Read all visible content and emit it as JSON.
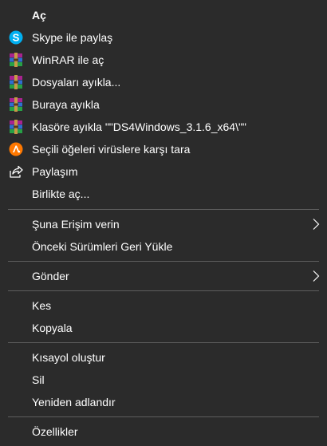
{
  "menu": {
    "items": [
      {
        "label": "Aç"
      },
      {
        "label": "Skype ile paylaş"
      },
      {
        "label": "WinRAR ile aç"
      },
      {
        "label": "Dosyaları ayıkla..."
      },
      {
        "label": "Buraya ayıkla"
      },
      {
        "label": "Klasöre ayıkla \"\"DS4Windows_3.1.6_x64\\\"\""
      },
      {
        "label": "Seçili öğeleri virüslere karşı tara"
      },
      {
        "label": "Paylaşım"
      },
      {
        "label": "Birlikte aç..."
      },
      {
        "label": "Şuna Erişim verin"
      },
      {
        "label": "Önceki Sürümleri Geri Yükle"
      },
      {
        "label": "Gönder"
      },
      {
        "label": "Kes"
      },
      {
        "label": "Kopyala"
      },
      {
        "label": "Kısayol oluştur"
      },
      {
        "label": "Sil"
      },
      {
        "label": "Yeniden adlandır"
      },
      {
        "label": "Özellikler"
      }
    ]
  },
  "icons": {
    "skype": "skype-icon",
    "winrar": "winrar-icon",
    "antivirus": "antivirus-icon",
    "share": "share-icon",
    "submenu": "chevron-right-icon"
  },
  "colors": {
    "background": "#2b2b2b",
    "text": "#ffffff",
    "separator": "#5e5e5e",
    "skype": "#00aff0",
    "antivirus": "#ff7800"
  }
}
